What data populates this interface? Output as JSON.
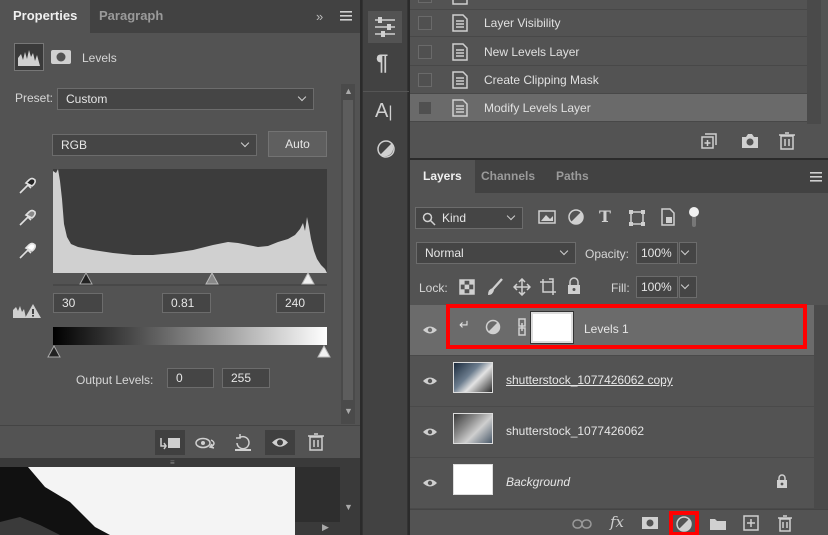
{
  "properties": {
    "tabs": [
      "Properties",
      "Paragraph"
    ],
    "panel_title": "Levels",
    "preset_label": "Preset:",
    "preset_value": "Custom",
    "channel_value": "RGB",
    "auto_label": "Auto",
    "input_levels": {
      "black": "30",
      "gamma": "0.81",
      "white": "240"
    },
    "output_label": "Output Levels:",
    "output_levels": {
      "black": "0",
      "white": "255"
    }
  },
  "actions": {
    "items": [
      {
        "label": "Layer Visibility",
        "selected": false
      },
      {
        "label": "New Levels Layer",
        "selected": false
      },
      {
        "label": "Create Clipping Mask",
        "selected": false
      },
      {
        "label": "Modify Levels Layer",
        "selected": true
      }
    ]
  },
  "layers": {
    "tabs": [
      "Layers",
      "Channels",
      "Paths"
    ],
    "filter_kind": "Kind",
    "blend_mode": "Normal",
    "opacity_label": "Opacity:",
    "opacity_value": "100%",
    "lock_label": "Lock:",
    "fill_label": "Fill:",
    "fill_value": "100%",
    "items": [
      {
        "name": "Levels 1",
        "type": "adjustment",
        "selected": true
      },
      {
        "name": "shutterstock_1077426062 copy",
        "type": "image",
        "selected": false
      },
      {
        "name": "shutterstock_1077426062",
        "type": "image",
        "selected": false
      },
      {
        "name": "Background",
        "type": "background",
        "selected": false
      }
    ]
  },
  "colors": {
    "highlight": "#ff0000",
    "panel": "#535353",
    "selected_row": "#6b6b6b"
  }
}
